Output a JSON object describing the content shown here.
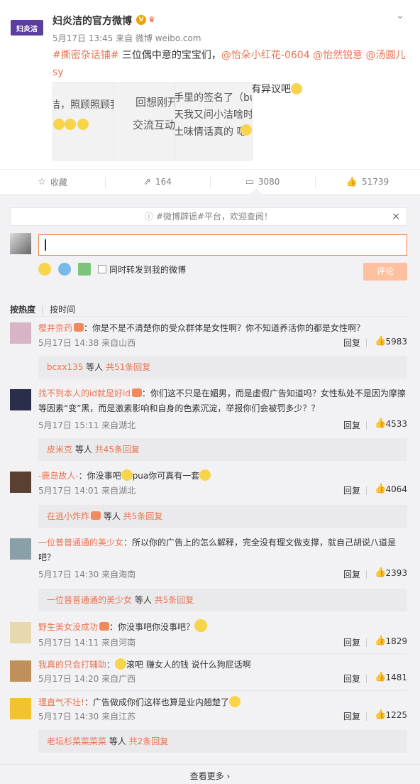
{
  "post": {
    "logo_text": "妇炎洁",
    "author": "妇炎洁的官方微博",
    "meta": "5月17日 13:45 来自 微博 weibo.com",
    "text_topic": "#撕密杂话铺#",
    "text_main": " 三位偶中意的宝宝们，",
    "mentions": [
      "@怡朵小红花-0604",
      "@怡然锐意",
      "@汤圆儿sy"
    ],
    "text_tail": "，签名照归你们了，地址地址……以上大家没有异议吧",
    "thumbs": [
      {
        "lines": [
          "洁，照顾照顾我滋"
        ]
      },
      {
        "lines": [
          "回想刚开始关注",
          "交流互动，像朋友"
        ]
      },
      {
        "lines": [
          "手里的签名了（bush",
          "天我又问小洁啥时候",
          "土味情话真的 嗯"
        ]
      }
    ]
  },
  "actions": {
    "favorite": "收藏",
    "forward": "164",
    "comment": "3080",
    "like": "51739"
  },
  "notice": "#微博辟谣#平台，欢迎查阅！",
  "composer": {
    "sync_label": "同时转发到我的微博",
    "submit": "评论"
  },
  "sort": {
    "hot": "按热度",
    "time": "按时间"
  },
  "labels": {
    "reply": "回复",
    "see_more": "查看更多"
  },
  "comments": [
    {
      "user": "樱井奈药",
      "text": "：你是不是不清楚你的受众群体是女性啊？你不知道养活你的都是女性啊？",
      "time": "5月17日 14:38 来自山西",
      "likes": "5983",
      "more_user": "bcxx135",
      "more_text": " 等人 ",
      "more_count": "共51条回复",
      "avatar_color": "#d7b4c6"
    },
    {
      "user": "找不到本人的id就是好id",
      "text": "：你们这不只是在媚男，而是虚假广告知道吗？女性私处不是因为摩擦等因素“变”黑，而是激素影响和自身的色素沉淀，举报你们会被罚多少？？",
      "time": "5月17日 15:11 来自湖北",
      "likes": "4533",
      "more_user": "皮米克",
      "more_text": " 等人 ",
      "more_count": "共45条回复",
      "avatar_color": "#2a2e4a"
    },
    {
      "user": "-鹿岛故人-",
      "text": "：你没事吧",
      "text2": "pua你可真有一套",
      "time": "5月17日 14:01 来自湖北",
      "likes": "4064",
      "more_user": "在逃小炸炸",
      "more_text": " 等人 ",
      "more_count": "共5条回复",
      "avatar_color": "#5a4030"
    },
    {
      "user": "一位普普通通的美少女",
      "text": "：所以你的广告上的怎么解释，完全没有理文做支撑，就自己胡说八道是吧？",
      "time": "5月17日 14:30 来自海南",
      "likes": "2393",
      "more_user": "一位普普通通的美少女",
      "more_text": " 等人 ",
      "more_count": "共5条回复",
      "avatar_color": "#8aa0a8"
    },
    {
      "user": "野生美女没成功",
      "text": "：你没事吧你没事吧？",
      "time": "5月17日 14:11 来自河南",
      "likes": "1829",
      "avatar_color": "#e8d8b0"
    },
    {
      "user": "我真的只会打辅助",
      "text": "滚吧 赚女人的钱 说什么狗屁话啊",
      "time": "5月17日 14:20 来自广西",
      "likes": "1481",
      "avatar_color": "#c0905a"
    },
    {
      "user": "理直气不壮!",
      "text": "：广告做成你们这样也算是业内翘楚了",
      "time": "5月17日 14:30 来自江苏",
      "likes": "1225",
      "more_user": "老坛杉菜菜菜菜",
      "more_text": " 等人 ",
      "more_count": "共2条回复",
      "avatar_color": "#f2c230"
    }
  ]
}
